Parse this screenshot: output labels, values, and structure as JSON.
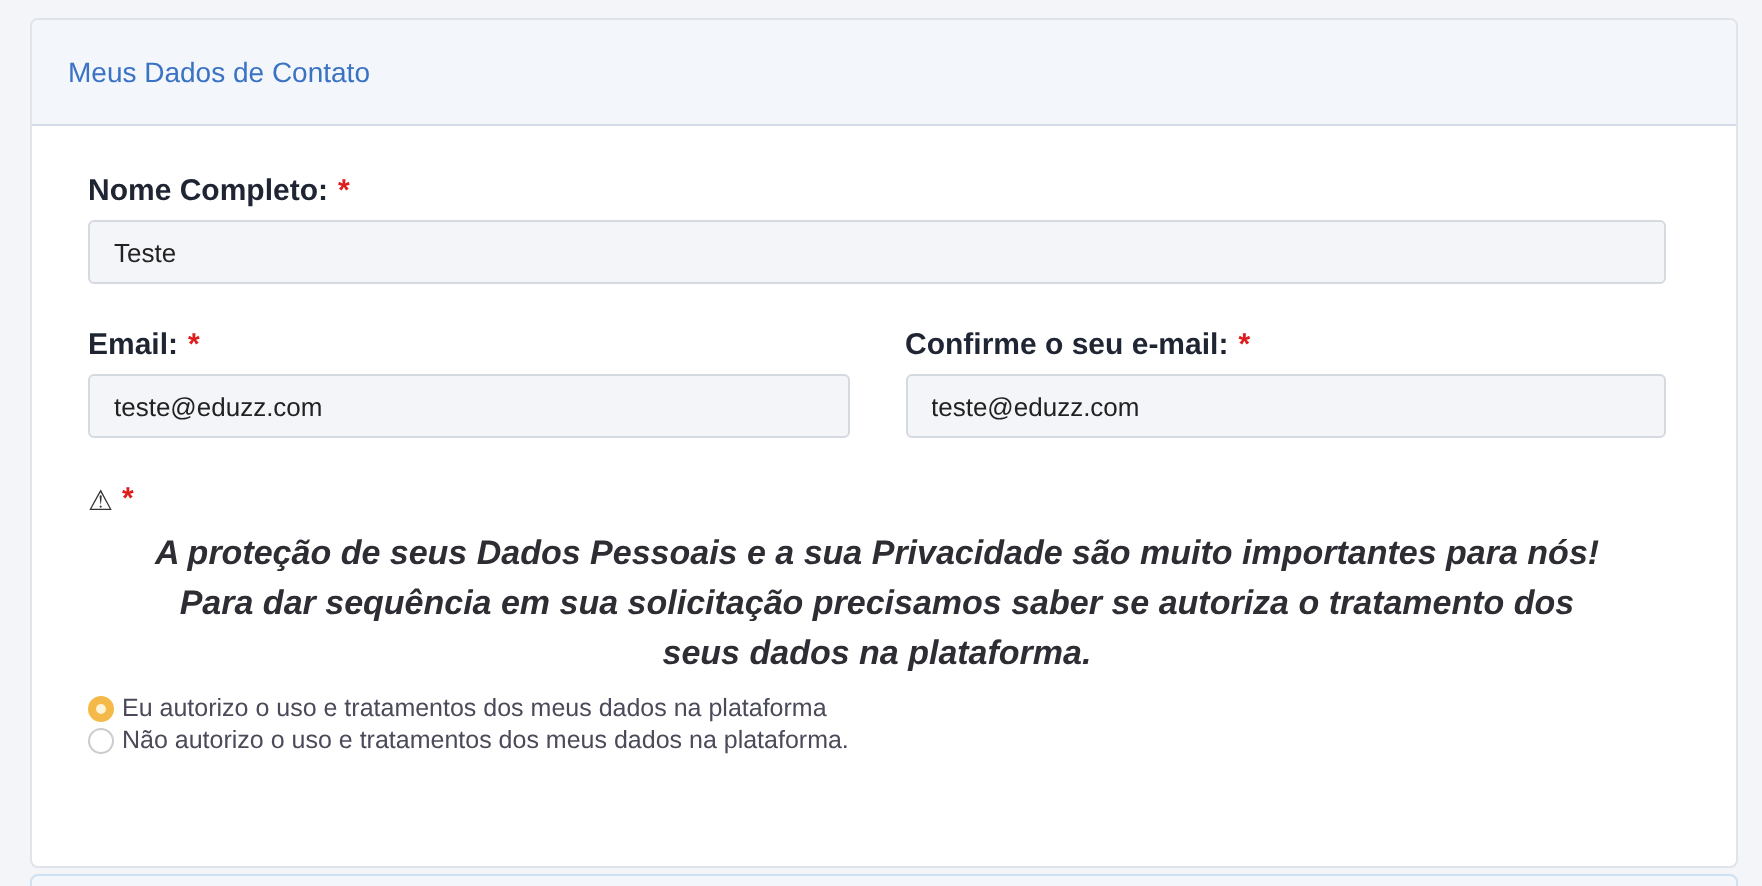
{
  "card": {
    "title": "Meus Dados de Contato"
  },
  "fields": [
    {
      "label": "Nome Completo:",
      "required": "*",
      "value": "Teste",
      "kind": "wide"
    },
    {
      "label": "Email:",
      "required": "*",
      "value": "teste@eduzz.com",
      "kind": "narrow"
    },
    {
      "label": "Confirme o seu e-mail:",
      "required": "*",
      "value": "teste@eduzz.com",
      "kind": "narrow"
    }
  ],
  "consent": {
    "icon": "⚠",
    "required": "*",
    "message": [
      "A proteção de seus Dados Pessoais e a sua Privacidade são muito importantes para nós!",
      "Para dar sequência em sua solicitação precisamos saber se autoriza o tratamento dos",
      "seus dados na plataforma."
    ],
    "options": [
      {
        "label": "Eu autorizo o uso e tratamentos dos meus dados na plataforma",
        "selected": true
      },
      {
        "label": "Não autorizo o uso e tratamentos dos meus dados na plataforma.",
        "selected": false
      }
    ]
  }
}
